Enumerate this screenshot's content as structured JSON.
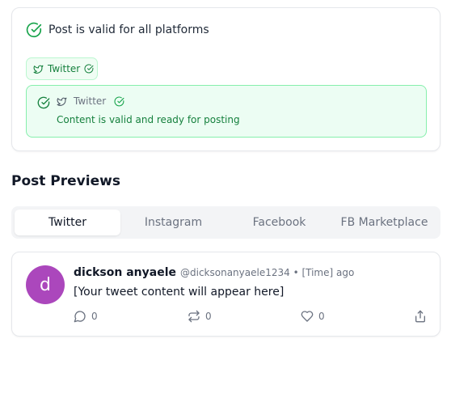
{
  "validation": {
    "title": "Post is valid for all platforms",
    "badge": {
      "platform": "Twitter"
    },
    "status": {
      "platform": "Twitter",
      "message": "Content is valid and ready for posting"
    }
  },
  "previews": {
    "title": "Post Previews",
    "tabs": [
      "Twitter",
      "Instagram",
      "Facebook",
      "FB Marketplace"
    ],
    "active_tab": "Twitter"
  },
  "tweet": {
    "avatar_letter": "d",
    "avatar_color": "#ab47bc",
    "name": "dickson anyaele",
    "meta": "@dicksonanyaele1234 • [Time] ago",
    "content": "[Your tweet content will appear here]",
    "replies": "0",
    "retweets": "0",
    "likes": "0"
  },
  "colors": {
    "valid_green": "#16a34a",
    "valid_bg": "#ecfdf3"
  },
  "icons": {
    "valid": "check-circle-icon",
    "platform": "twitter-bird-icon",
    "reply": "comment-icon",
    "retweet": "retweet-icon",
    "like": "heart-icon",
    "share": "share-icon"
  }
}
